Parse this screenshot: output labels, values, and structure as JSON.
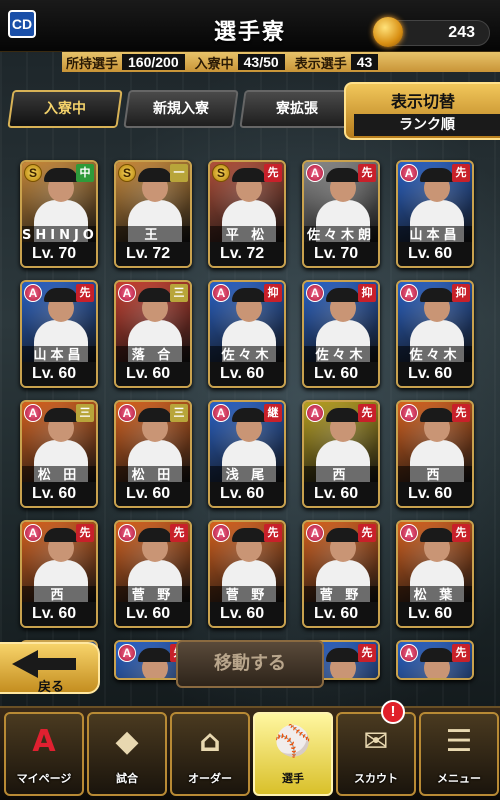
{
  "header": {
    "title": "選手寮",
    "team_logo": "CD",
    "coins": "243",
    "coin_icon": "gold-flame-coin-icon"
  },
  "stats": {
    "owned_label": "所持選手",
    "owned_value": "160/200",
    "dorm_label": "入寮中",
    "dorm_value": "43/50",
    "shown_label": "表示選手",
    "shown_value": "43"
  },
  "tabs": [
    {
      "label": "入寮中",
      "active": true
    },
    {
      "label": "新規入寮",
      "active": false
    },
    {
      "label": "寮拡張",
      "active": false
    }
  ],
  "view_toggle": {
    "label": "表示切替",
    "sort": "ランク順"
  },
  "cards": [
    {
      "name": "SHINJO",
      "lv": "Lv. 70",
      "rank": "S",
      "pos": "中",
      "pos_color": "#2e9b3a",
      "bg": "#c98a3a"
    },
    {
      "name": "王",
      "lv": "Lv. 72",
      "rank": "S",
      "pos": "一",
      "pos_color": "#b8a53a",
      "bg": "#c98a3a"
    },
    {
      "name": "平 松",
      "lv": "Lv. 72",
      "rank": "S",
      "pos": "先",
      "pos_color": "#c8202a",
      "bg": "#b2503a"
    },
    {
      "name": "佐々木朗",
      "lv": "Lv. 70",
      "rank": "A",
      "pos": "先",
      "pos_color": "#c8202a",
      "bg": "#8a8a8a"
    },
    {
      "name": "山本昌",
      "lv": "Lv. 60",
      "rank": "A",
      "pos": "先",
      "pos_color": "#c8202a",
      "bg": "#2a63c8"
    },
    {
      "name": "山本昌",
      "lv": "Lv. 60",
      "rank": "A",
      "pos": "先",
      "pos_color": "#c8202a",
      "bg": "#2a63c8"
    },
    {
      "name": "落 合",
      "lv": "Lv. 60",
      "rank": "A",
      "pos": "三",
      "pos_color": "#b8a53a",
      "bg": "#c84030"
    },
    {
      "name": "佐々木",
      "lv": "Lv. 60",
      "rank": "A",
      "pos": "抑",
      "pos_color": "#c8202a",
      "bg": "#2a63c8"
    },
    {
      "name": "佐々木",
      "lv": "Lv. 60",
      "rank": "A",
      "pos": "抑",
      "pos_color": "#c8202a",
      "bg": "#2a63c8"
    },
    {
      "name": "佐々木",
      "lv": "Lv. 60",
      "rank": "A",
      "pos": "抑",
      "pos_color": "#c8202a",
      "bg": "#2a63c8"
    },
    {
      "name": "松 田",
      "lv": "Lv. 60",
      "rank": "A",
      "pos": "三",
      "pos_color": "#b8a53a",
      "bg": "#d8621e"
    },
    {
      "name": "松 田",
      "lv": "Lv. 60",
      "rank": "A",
      "pos": "三",
      "pos_color": "#b8a53a",
      "bg": "#d8621e"
    },
    {
      "name": "浅 尾",
      "lv": "Lv. 60",
      "rank": "A",
      "pos": "継",
      "pos_color": "#c8202a",
      "bg": "#2a63c8"
    },
    {
      "name": "西",
      "lv": "Lv. 60",
      "rank": "A",
      "pos": "先",
      "pos_color": "#c8202a",
      "bg": "#b8a020"
    },
    {
      "name": "西",
      "lv": "Lv. 60",
      "rank": "A",
      "pos": "先",
      "pos_color": "#c8202a",
      "bg": "#d8621e"
    },
    {
      "name": "西",
      "lv": "Lv. 60",
      "rank": "A",
      "pos": "先",
      "pos_color": "#c8202a",
      "bg": "#d8621e"
    },
    {
      "name": "菅 野",
      "lv": "Lv. 60",
      "rank": "A",
      "pos": "先",
      "pos_color": "#c8202a",
      "bg": "#d8621e"
    },
    {
      "name": "菅 野",
      "lv": "Lv. 60",
      "rank": "A",
      "pos": "先",
      "pos_color": "#c8202a",
      "bg": "#d8621e"
    },
    {
      "name": "菅 野",
      "lv": "Lv. 60",
      "rank": "A",
      "pos": "先",
      "pos_color": "#c8202a",
      "bg": "#d8621e"
    },
    {
      "name": "松 葉",
      "lv": "Lv. 60",
      "rank": "A",
      "pos": "先",
      "pos_color": "#c8202a",
      "bg": "#d8621e"
    },
    {
      "name": "",
      "lv": "",
      "rank": "A",
      "pos": "先",
      "pos_color": "#c8202a",
      "bg": "#2a63c8"
    },
    {
      "name": "",
      "lv": "",
      "rank": "A",
      "pos": "先",
      "pos_color": "#c8202a",
      "bg": "#2a63c8"
    },
    {
      "name": "",
      "lv": "",
      "rank": "A",
      "pos": "先",
      "pos_color": "#c8202a",
      "bg": "#2a63c8"
    },
    {
      "name": "",
      "lv": "",
      "rank": "A",
      "pos": "先",
      "pos_color": "#c8202a",
      "bg": "#2a63c8"
    },
    {
      "name": "",
      "lv": "",
      "rank": "A",
      "pos": "先",
      "pos_color": "#c8202a",
      "bg": "#2a63c8"
    }
  ],
  "buttons": {
    "back": "戻る",
    "move": "移動する"
  },
  "nav": [
    {
      "label": "マイページ",
      "icon": "A",
      "active": false
    },
    {
      "label": "試合",
      "icon": "◆",
      "active": false
    },
    {
      "label": "オーダー",
      "icon": "⌂",
      "active": false
    },
    {
      "label": "選手",
      "icon": "⚾",
      "active": true
    },
    {
      "label": "スカウト",
      "icon": "✉",
      "active": false
    },
    {
      "label": "メニュー",
      "icon": "☰",
      "active": false
    }
  ],
  "scout_badge": "!"
}
